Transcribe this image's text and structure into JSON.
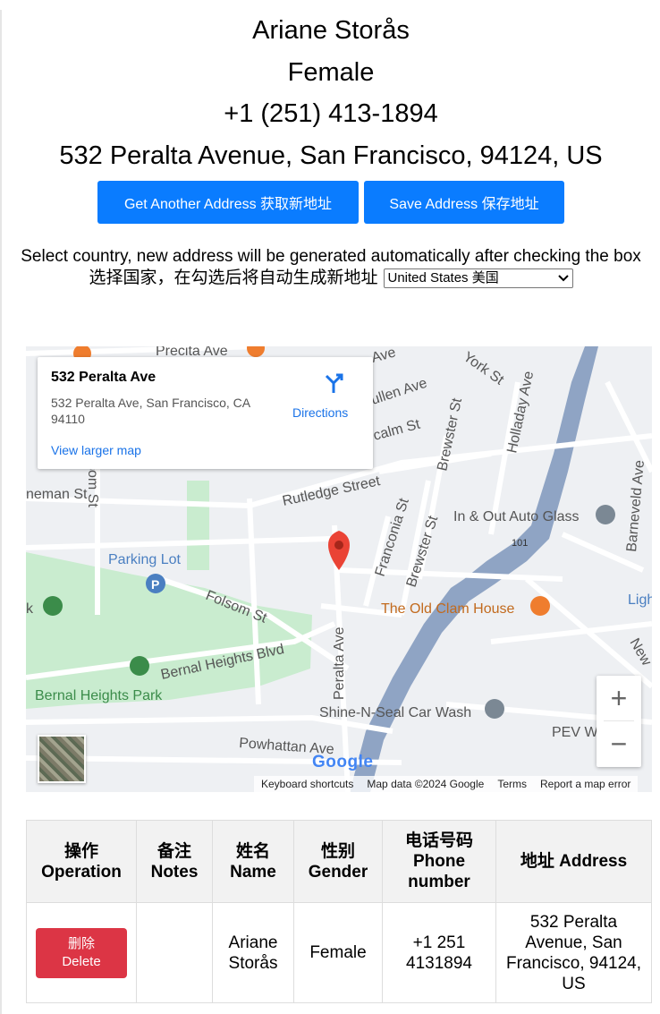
{
  "person": {
    "name": "Ariane Storås",
    "gender": "Female",
    "phone": "+1 (251) 413-1894",
    "address": "532 Peralta Avenue, San Francisco, 94124, US"
  },
  "buttons": {
    "another": "Get Another Address 获取新地址",
    "save": "Save Address 保存地址"
  },
  "country_selector": {
    "instruction_en": "Select country, new address will be generated automatically after checking the box",
    "instruction_zh": "选择国家，在勾选后将自动生成新地址",
    "selected": "United States 美国"
  },
  "map": {
    "card_title": "532 Peralta Ave",
    "card_address": "532 Peralta Ave, San Francisco, CA 94110",
    "directions": "Directions",
    "larger_map": "View larger map",
    "streets": [
      "Precita Ave",
      "Ave",
      "York St",
      "Holladay Ave",
      "ullen Ave",
      "calm St",
      "Brewster St",
      "neman St",
      "som St",
      "Rutledge Street",
      "In & Out Auto Glass",
      "Barneveld Ave",
      "Franconia St",
      "Brewster St",
      "Parking Lot",
      "Folsom St",
      "The Old Clam House",
      "Ligh",
      "New",
      "Bernal Heights Blvd",
      "Bernal Heights Park",
      "Peralta Ave",
      "Shine-N-Seal Car Wash",
      "PEV W",
      "Powhattan Ave",
      "k",
      "101"
    ],
    "logo": "Google",
    "attribution": [
      "Keyboard shortcuts",
      "Map data ©2024 Google",
      "Terms",
      "Report a map error"
    ],
    "zoom_in": "+",
    "zoom_out": "−"
  },
  "table": {
    "headers": [
      {
        "zh": "操作",
        "en": "Operation"
      },
      {
        "zh": "备注",
        "en": "Notes"
      },
      {
        "zh": "姓名",
        "en": "Name"
      },
      {
        "zh": "性别",
        "en": "Gender"
      },
      {
        "zh": "电话号码",
        "en": "Phone number"
      },
      {
        "zh": "地址",
        "en": "Address"
      }
    ],
    "row": {
      "delete_zh": "删除",
      "delete_en": "Delete",
      "notes": "",
      "name": "Ariane Storås",
      "gender": "Female",
      "phone": "+1 251 4131894",
      "address": "532 Peralta Avenue, San Francisco, 94124, US"
    }
  },
  "colors": {
    "primary_button": "#0a7cff",
    "delete_button": "#dc3545",
    "map_pin": "#ea4335",
    "park": "#c9eccf",
    "freeway": "#8fa4c4"
  }
}
